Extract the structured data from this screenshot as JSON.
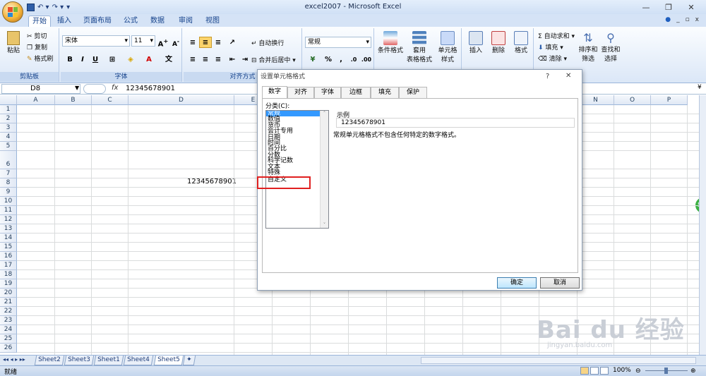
{
  "window": {
    "title": "excel2007 - Microsoft Excel"
  },
  "qat": {
    "undo": "↶ ▾",
    "redo": "↷ ▾",
    "dropdown": "▾"
  },
  "tabs": [
    "开始",
    "插入",
    "页面布局",
    "公式",
    "数据",
    "审阅",
    "视图"
  ],
  "ribbon": {
    "clipboard": {
      "paste": "粘贴",
      "cut": "剪切",
      "copy": "复制",
      "painter": "格式刷",
      "label": "剪贴板"
    },
    "font": {
      "name": "宋体",
      "size": "11",
      "label": "字体",
      "bold": "B",
      "italic": "I",
      "underline": "U"
    },
    "align": {
      "wrap": "自动换行",
      "merge": "合并后居中",
      "label": "对齐方式"
    },
    "number": {
      "format": "常规",
      "percent": "%",
      "comma": ","
    },
    "styles": {
      "cond": "条件格式",
      "table": "套用\n表格格式",
      "cell": "单元格\n样式"
    },
    "cells": {
      "insert": "插入",
      "delete": "删除",
      "format": "格式"
    },
    "editing": {
      "autosum": "自动求和",
      "fill": "填充",
      "clear": "清除",
      "sort": "排序和\n筛选",
      "find": "查找和\n选择"
    }
  },
  "formula_bar": {
    "name": "D8",
    "fx": "fx",
    "value": "12345678901"
  },
  "columns": [
    "A",
    "B",
    "C",
    "D",
    "E",
    "F",
    "G",
    "H",
    "I",
    "J",
    "K",
    "L",
    "M",
    "N",
    "O",
    "P"
  ],
  "rows": [
    "1",
    "2",
    "3",
    "4",
    "5",
    "6",
    "7",
    "8",
    "9",
    "10",
    "11",
    "12",
    "13",
    "14",
    "15",
    "16",
    "17",
    "18",
    "19",
    "20",
    "21",
    "22",
    "23",
    "24",
    "25",
    "26"
  ],
  "cell_value": "12345678901",
  "sheets": [
    "Sheet2",
    "Sheet3",
    "Sheet1",
    "Sheet4",
    "Sheet5"
  ],
  "status": {
    "ready": "就绪",
    "zoom": "100%"
  },
  "dialog": {
    "title": "设置单元格格式",
    "help": "?",
    "close": "✕",
    "tabs": [
      "数字",
      "对齐",
      "字体",
      "边框",
      "填充",
      "保护"
    ],
    "category_label": "分类(C):",
    "categories": [
      "常规",
      "数值",
      "货币",
      "会计专用",
      "日期",
      "时间",
      "百分比",
      "分数",
      "科学记数",
      "文本",
      "特殊",
      "自定义"
    ],
    "sample_label": "示例",
    "sample_value": "12345678901",
    "description": "常规单元格格式不包含任何特定的数字格式。",
    "ok": "确定",
    "cancel": "取消"
  },
  "watermark": {
    "main": "Bai du 经验",
    "sub": "jingyan.baidu.com"
  },
  "badge": "56"
}
